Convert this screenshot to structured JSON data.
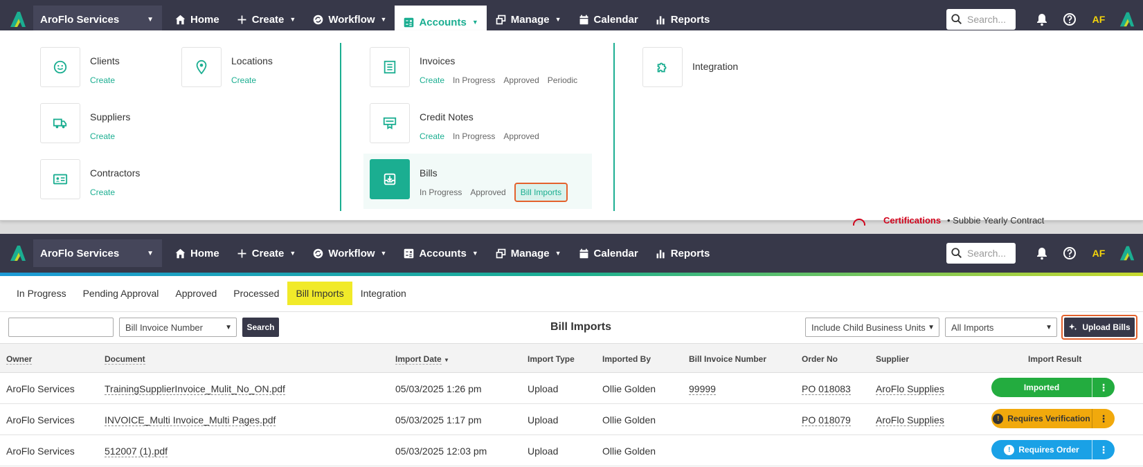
{
  "app": {
    "business_unit": "AroFlo Services",
    "initials": "AF",
    "search_placeholder": "Search..."
  },
  "nav": {
    "items": [
      {
        "label": "Home",
        "icon": "home-icon"
      },
      {
        "label": "Create",
        "icon": "plus-icon"
      },
      {
        "label": "Workflow",
        "icon": "workflow-icon"
      },
      {
        "label": "Accounts",
        "icon": "accounts-icon"
      },
      {
        "label": "Manage",
        "icon": "manage-icon"
      },
      {
        "label": "Calendar",
        "icon": "calendar-icon"
      },
      {
        "label": "Reports",
        "icon": "reports-icon"
      }
    ]
  },
  "mega": {
    "clients": {
      "title": "Clients",
      "links": [
        "Create"
      ]
    },
    "locations": {
      "title": "Locations",
      "links": [
        "Create"
      ]
    },
    "suppliers": {
      "title": "Suppliers",
      "links": [
        "Create"
      ]
    },
    "contractors": {
      "title": "Contractors",
      "links": [
        "Create"
      ]
    },
    "invoices": {
      "title": "Invoices",
      "links": [
        "Create",
        "In Progress",
        "Approved",
        "Periodic"
      ]
    },
    "credit_notes": {
      "title": "Credit Notes",
      "links": [
        "Create",
        "In Progress",
        "Approved"
      ]
    },
    "bills": {
      "title": "Bills",
      "links": [
        "In Progress",
        "Approved",
        "Bill Imports"
      ]
    },
    "integration": {
      "title": "Integration"
    }
  },
  "peek": {
    "label": "Certifications",
    "text": "• Subbie Yearly Contract"
  },
  "subtabs": [
    "In Progress",
    "Pending Approval",
    "Approved",
    "Processed",
    "Bill Imports",
    "Integration"
  ],
  "toolbar": {
    "field_select": "Bill Invoice Number",
    "search_label": "Search",
    "title": "Bill Imports",
    "bu_filter": "Include Child Business Units",
    "import_filter": "All Imports",
    "upload_label": "Upload Bills"
  },
  "table": {
    "headers": [
      "Owner",
      "Document",
      "Import Date",
      "Import Type",
      "Imported By",
      "Bill Invoice Number",
      "Order No",
      "Supplier",
      "Import Result"
    ],
    "rows": [
      {
        "owner": "AroFlo Services",
        "document": "TrainingSupplierInvoice_Mulit_No_ON.pdf",
        "date": "05/03/2025 1:26 pm",
        "type": "Upload",
        "by": "Ollie Golden",
        "invoice": "99999",
        "order": "PO 018083",
        "supplier": "AroFlo Supplies",
        "result": "Imported",
        "status": "green"
      },
      {
        "owner": "AroFlo Services",
        "document": "INVOICE_Multi Invoice_Multi Pages.pdf",
        "date": "05/03/2025 1:17 pm",
        "type": "Upload",
        "by": "Ollie Golden",
        "invoice": "",
        "order": "PO 018079",
        "supplier": "AroFlo Supplies",
        "result": "Requires Verification",
        "status": "amber"
      },
      {
        "owner": "AroFlo Services",
        "document": "512007 (1).pdf",
        "date": "05/03/2025 12:03 pm",
        "type": "Upload",
        "by": "Ollie Golden",
        "invoice": "",
        "order": "",
        "supplier": "",
        "result": "Requires Order",
        "status": "blue"
      }
    ]
  },
  "colors": {
    "nav_bg": "#373849",
    "accent": "#1bae91",
    "highlight": "#f1ea29",
    "callout": "#e4612c"
  }
}
